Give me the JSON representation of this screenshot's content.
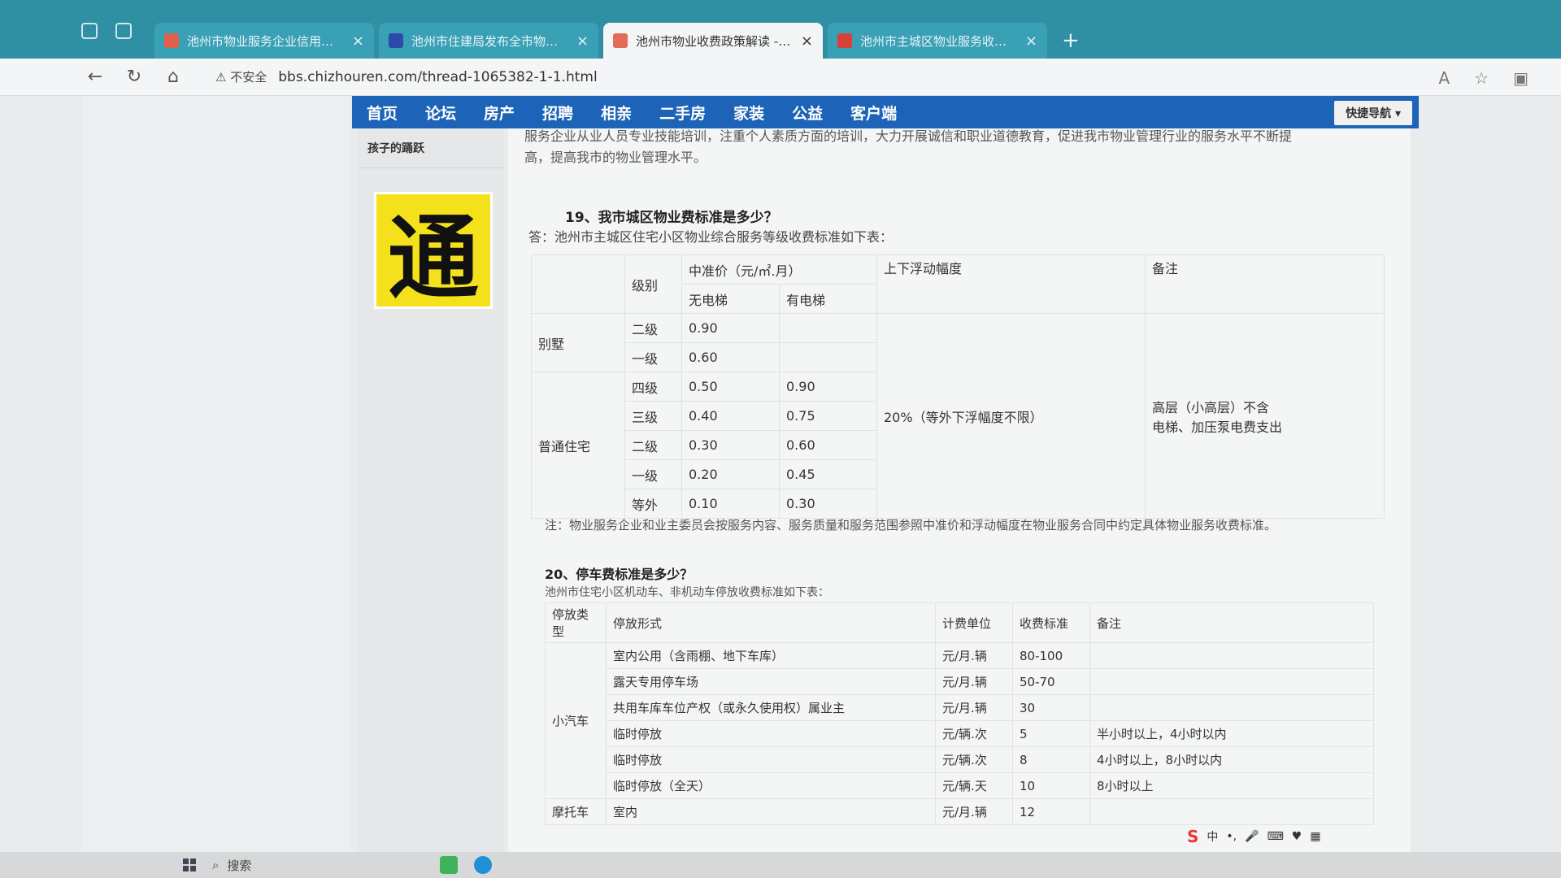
{
  "browser": {
    "tabs": [
      {
        "title": "池州市物业服务企业信用等级评",
        "active": false,
        "favicon_color": "#e0604c"
      },
      {
        "title": "池州市住建局发布全市物业服务",
        "active": false,
        "favicon_color": "#2c4aa8"
      },
      {
        "title": "池州市物业收费政策解读 - 池州",
        "active": true,
        "favicon_color": "#e36b5a"
      },
      {
        "title": "池州市主城区物业服务收费管理",
        "active": false,
        "favicon_color": "#d9403a"
      }
    ],
    "tab_close": "×",
    "new_tab": "+",
    "security_label": "不安全",
    "url": "bbs.chizhouren.com/thread-1065382-1-1.html"
  },
  "site_nav": {
    "items": [
      "首页",
      "论坛",
      "房产",
      "招聘",
      "相亲",
      "二手房",
      "家装",
      "公益",
      "客户端"
    ],
    "quick_nav": "快捷导航"
  },
  "sidebar": {
    "title": "孩子的踊跃",
    "logo_char": "通"
  },
  "article": {
    "prev_line1": "服务企业从业人员专业技能培训，注重个人素质方面的培训，大力开展诚信和职业道德教育，促进我市物业管理行业的服务水平不断提",
    "prev_line2": "高，提高我市的物业管理水平。",
    "q19": "19、我市城区物业费标准是多少？",
    "a19": "答：池州市主城区住宅小区物业综合服务等级收费标准如下表：",
    "t1_headers": {
      "level": "级别",
      "base_price": "中准价（元/㎡.月）",
      "no_elevator": "无电梯",
      "with_elevator": "有电梯",
      "float_range": "上下浮动幅度",
      "remark": "备注"
    },
    "t1_rows": [
      {
        "type": "别墅",
        "level": "二级",
        "no_elevator": "0.90",
        "with_elevator": ""
      },
      {
        "type": "",
        "level": "一级",
        "no_elevator": "0.60",
        "with_elevator": ""
      },
      {
        "type": "普通住宅",
        "level": "四级",
        "no_elevator": "0.50",
        "with_elevator": "0.90"
      },
      {
        "type": "",
        "level": "三级",
        "no_elevator": "0.40",
        "with_elevator": "0.75"
      },
      {
        "type": "",
        "level": "二级",
        "no_elevator": "0.30",
        "with_elevator": "0.60"
      },
      {
        "type": "",
        "level": "一级",
        "no_elevator": "0.20",
        "with_elevator": "0.45"
      },
      {
        "type": "",
        "level": "等外",
        "no_elevator": "0.10",
        "with_elevator": "0.30"
      }
    ],
    "t1_float_value": "20%（等外下浮幅度不限）",
    "t1_remark_line1": "高层（小高层）不含",
    "t1_remark_line2": "电梯、加压泵电费支出",
    "note": "注：物业服务企业和业主委员会按服务内容、服务质量和服务范围参照中准价和浮动幅度在物业服务合同中约定具体物业服务收费标准。",
    "q20": "20、停车费标准是多少？",
    "a20": "池州市住宅小区机动车、非机动车停放收费标准如下表：",
    "t2_headers": {
      "type": "停放类型",
      "form": "停放形式",
      "unit": "计费单位",
      "fee": "收费标准",
      "remark": "备注"
    },
    "t2_car_label": "小汽车",
    "t2_car_rows": [
      {
        "form": "室内公用（含雨棚、地下车库）",
        "unit": "元/月.辆",
        "fee": "80-100",
        "remark": ""
      },
      {
        "form": "露天专用停车场",
        "unit": "元/月.辆",
        "fee": "50-70",
        "remark": ""
      },
      {
        "form": "共用车库车位产权（或永久使用权）属业主",
        "unit": "元/月.辆",
        "fee": "30",
        "remark": ""
      },
      {
        "form": "临时停放",
        "unit": "元/辆.次",
        "fee": "5",
        "remark": "半小时以上，4小时以内"
      },
      {
        "form": "临时停放",
        "unit": "元/辆.次",
        "fee": "8",
        "remark": "4小时以上，8小时以内"
      },
      {
        "form": "临时停放（全天）",
        "unit": "元/辆.天",
        "fee": "10",
        "remark": "8小时以上"
      }
    ],
    "t2_moto_label": "摩托车",
    "t2_moto_row": {
      "form": "室内",
      "unit": "元/月.辆",
      "fee": "12",
      "remark": ""
    }
  },
  "taskbar": {
    "search_label": "搜索",
    "ime_label": "中"
  }
}
